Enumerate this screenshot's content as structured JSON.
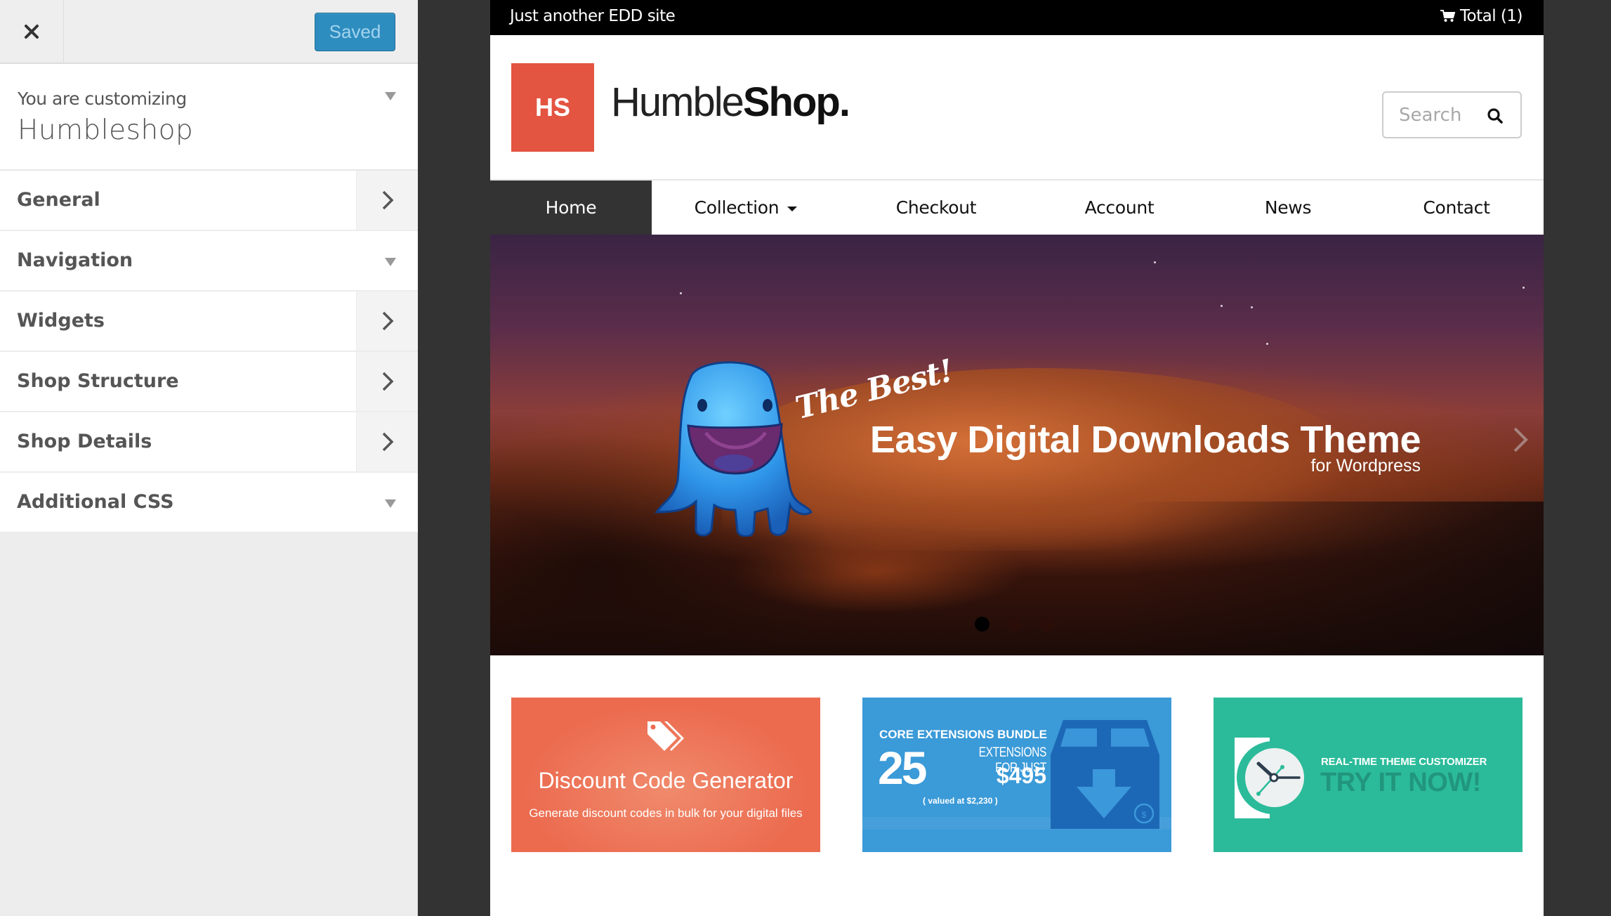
{
  "customizer": {
    "close_label": "Close",
    "save_button": "Saved",
    "info": {
      "label": "You are customizing",
      "theme_name": "Humbleshop"
    },
    "sections": [
      {
        "label": "General",
        "indicator": "chevron-right"
      },
      {
        "label": "Navigation",
        "indicator": "triangle-down"
      },
      {
        "label": "Widgets",
        "indicator": "chevron-right"
      },
      {
        "label": "Shop Structure",
        "indicator": "chevron-right"
      },
      {
        "label": "Shop Details",
        "indicator": "chevron-right"
      },
      {
        "label": "Additional CSS",
        "indicator": "triangle-down"
      }
    ]
  },
  "site": {
    "topbar": {
      "tagline": "Just another EDD site",
      "cart_label": "Total (1)"
    },
    "logo": {
      "mark": "HS",
      "name_light": "Humble",
      "name_bold": "Shop.",
      "mark_color": "#e35441"
    },
    "search": {
      "placeholder": "Search",
      "value": ""
    },
    "nav": [
      {
        "label": "Home",
        "active": true
      },
      {
        "label": "Collection",
        "dropdown": true
      },
      {
        "label": "Checkout"
      },
      {
        "label": "Account"
      },
      {
        "label": "News"
      },
      {
        "label": "Contact"
      }
    ],
    "slider": {
      "kicker": "The Best!",
      "headline": "Easy Digital Downloads Theme",
      "subhead": "for Wordpress",
      "slide_count": 3,
      "active_slide": 1
    },
    "promos": [
      {
        "title": "Discount Code Generator",
        "subtitle": "Generate discount codes in bulk for your digital files",
        "color": "#ec6b4f"
      },
      {
        "heading": "CORE EXTENSIONS BUNDLE",
        "count": "25",
        "for_text": "EXTENSIONS FOR JUST",
        "price": "$495",
        "valued": "( valued at $2,230 )",
        "color": "#3b9ad8"
      },
      {
        "heading": "REAL-TIME THEME CUSTOMIZER",
        "cta": "TRY IT NOW!",
        "color": "#2bbb9a"
      }
    ]
  }
}
